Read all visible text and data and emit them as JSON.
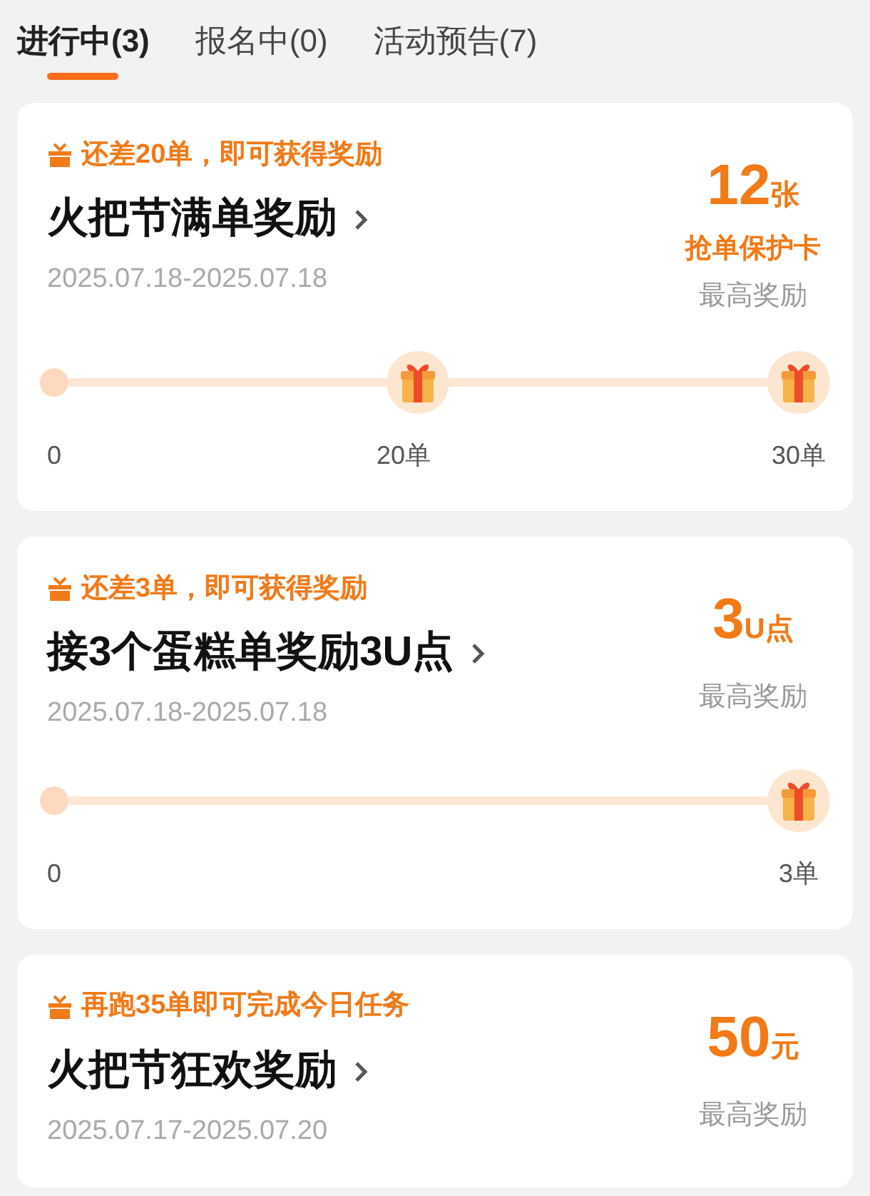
{
  "tabs": [
    {
      "label": "进行中(3)",
      "selected": true
    },
    {
      "label": "报名中(0)",
      "selected": false
    },
    {
      "label": "活动预告(7)",
      "selected": false
    }
  ],
  "activities": [
    {
      "hint": "还差20单，即可获得奖励",
      "title": "火把节满单奖励",
      "dates": "2025.07.18-2025.07.18",
      "reward": {
        "amount": "12",
        "unit": "张",
        "item": "抢单保护卡",
        "caption": "最高奖励"
      },
      "progress": {
        "start_label": "0",
        "milestones": [
          {
            "label": "20单"
          },
          {
            "label": "30单"
          }
        ]
      }
    },
    {
      "hint": "还差3单，即可获得奖励",
      "title": "接3个蛋糕单奖励3U点",
      "dates": "2025.07.18-2025.07.18",
      "reward": {
        "amount": "3",
        "unit": "U点",
        "caption": "最高奖励"
      },
      "progress": {
        "start_label": "0",
        "milestones": [
          {
            "label": "3单"
          }
        ]
      }
    },
    {
      "hint": "再跑35单即可完成今日任务",
      "title": "火把节狂欢奖励",
      "dates": "2025.07.17-2025.07.20",
      "reward": {
        "amount": "50",
        "unit": "元",
        "caption": "最高奖励"
      }
    }
  ]
}
